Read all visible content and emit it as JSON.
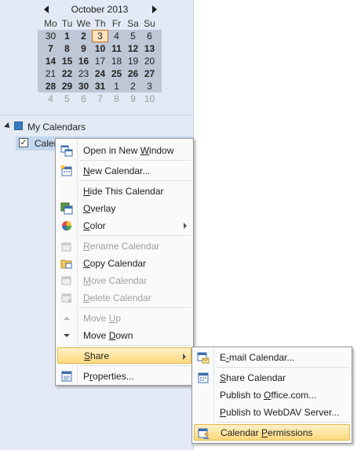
{
  "calendar_nav": {
    "month_title": "October 2013",
    "weekday_headers": [
      "Mo",
      "Tu",
      "We",
      "Th",
      "Fr",
      "Sa",
      "Su"
    ],
    "weeks": [
      [
        {
          "d": "30",
          "s": "normal"
        },
        {
          "d": "1",
          "s": "bold"
        },
        {
          "d": "2",
          "s": "bold"
        },
        {
          "d": "3",
          "s": "today"
        },
        {
          "d": "4",
          "s": "normal"
        },
        {
          "d": "5",
          "s": "normal"
        },
        {
          "d": "6",
          "s": "normal"
        }
      ],
      [
        {
          "d": "7",
          "s": "bold"
        },
        {
          "d": "8",
          "s": "bold"
        },
        {
          "d": "9",
          "s": "bold"
        },
        {
          "d": "10",
          "s": "bold"
        },
        {
          "d": "11",
          "s": "bold"
        },
        {
          "d": "12",
          "s": "bold"
        },
        {
          "d": "13",
          "s": "bold"
        }
      ],
      [
        {
          "d": "14",
          "s": "bold"
        },
        {
          "d": "15",
          "s": "bold"
        },
        {
          "d": "16",
          "s": "bold"
        },
        {
          "d": "17",
          "s": "normal"
        },
        {
          "d": "18",
          "s": "normal"
        },
        {
          "d": "19",
          "s": "normal"
        },
        {
          "d": "20",
          "s": "normal"
        }
      ],
      [
        {
          "d": "21",
          "s": "normal"
        },
        {
          "d": "22",
          "s": "bold"
        },
        {
          "d": "23",
          "s": "normal"
        },
        {
          "d": "24",
          "s": "bold"
        },
        {
          "d": "25",
          "s": "bold"
        },
        {
          "d": "26",
          "s": "bold"
        },
        {
          "d": "27",
          "s": "bold"
        }
      ],
      [
        {
          "d": "28",
          "s": "bold"
        },
        {
          "d": "29",
          "s": "bold"
        },
        {
          "d": "30",
          "s": "bold"
        },
        {
          "d": "31",
          "s": "bold"
        },
        {
          "d": "1",
          "s": "normal"
        },
        {
          "d": "2",
          "s": "normal"
        },
        {
          "d": "3",
          "s": "normal"
        }
      ]
    ],
    "next_month_row": [
      {
        "d": "4",
        "s": "dim"
      },
      {
        "d": "5",
        "s": "dim"
      },
      {
        "d": "6",
        "s": "dim"
      },
      {
        "d": "7",
        "s": "dim"
      },
      {
        "d": "8",
        "s": "dim"
      },
      {
        "d": "9",
        "s": "dim"
      },
      {
        "d": "10",
        "s": "dim"
      }
    ]
  },
  "folder_tree": {
    "group_label": "My Calendars",
    "item_label": "Calen",
    "item_checked": "✓"
  },
  "context_menu": {
    "items": [
      {
        "pre": "Open in New ",
        "ul": "W",
        "post": "indow",
        "icon": "open-window-icon",
        "disabled": false
      },
      {
        "pre": "",
        "ul": "N",
        "post": "ew Calendar...",
        "icon": "new-calendar-icon",
        "disabled": false
      },
      {
        "pre": "",
        "ul": "H",
        "post": "ide This Calendar",
        "icon": "",
        "disabled": false
      },
      {
        "pre": "",
        "ul": "O",
        "post": "verlay",
        "icon": "overlay-icon",
        "disabled": false
      },
      {
        "pre": "",
        "ul": "C",
        "post": "olor",
        "icon": "color-icon",
        "disabled": false
      },
      {
        "pre": "",
        "ul": "R",
        "post": "ename Calendar",
        "icon": "rename-icon",
        "disabled": true
      },
      {
        "pre": "",
        "ul": "C",
        "post": "opy Calendar",
        "icon": "copy-calendar-icon",
        "disabled": false
      },
      {
        "pre": "",
        "ul": "M",
        "post": "ove Calendar",
        "icon": "move-calendar-icon",
        "disabled": true
      },
      {
        "pre": "",
        "ul": "D",
        "post": "elete Calendar",
        "icon": "delete-calendar-icon",
        "disabled": true
      },
      {
        "pre": "Move ",
        "ul": "U",
        "post": "p",
        "icon": "move-up-icon",
        "disabled": true
      },
      {
        "pre": "Move ",
        "ul": "D",
        "post": "own",
        "icon": "move-down-icon",
        "disabled": false
      },
      {
        "pre": "",
        "ul": "S",
        "post": "hare",
        "icon": "",
        "disabled": false
      },
      {
        "pre": "P",
        "ul": "r",
        "post": "operties...",
        "icon": "properties-icon",
        "disabled": false
      }
    ]
  },
  "share_submenu": {
    "items": [
      {
        "pre": "E",
        "ul": "-",
        "post": "mail Calendar...",
        "icon": "email-calendar-icon"
      },
      {
        "pre": "",
        "ul": "S",
        "post": "hare Calendar",
        "icon": "share-calendar-icon"
      },
      {
        "pre": "Publish to ",
        "ul": "O",
        "post": "ffice.com...",
        "icon": ""
      },
      {
        "pre": "",
        "ul": "P",
        "post": "ublish to WebDAV Server...",
        "icon": ""
      },
      {
        "pre": "Calendar ",
        "ul": "P",
        "post": "ermissions",
        "icon": "calendar-permissions-icon"
      }
    ]
  },
  "colors": {
    "nav_background": "#e3eaf5",
    "highlight_top": "#fdf1c7",
    "highlight_bottom": "#fcd97c",
    "today_border": "#d8691e"
  }
}
